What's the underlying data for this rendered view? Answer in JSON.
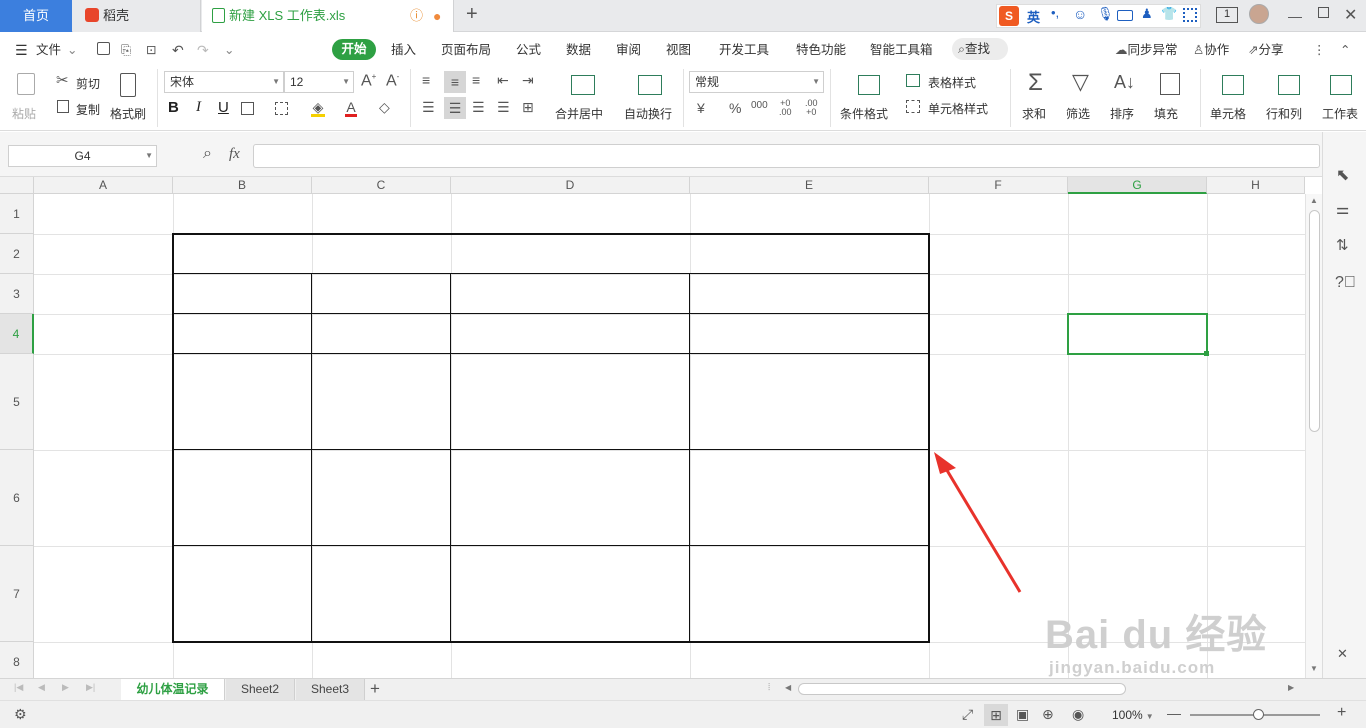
{
  "tabs": {
    "home": "首页",
    "docer": "稻壳",
    "doc": "新建 XLS 工作表.xls"
  },
  "ribbon_tabs": [
    "开始",
    "插入",
    "页面布局",
    "公式",
    "数据",
    "审阅",
    "视图",
    "开发工具",
    "特色功能",
    "智能工具箱"
  ],
  "menu": {
    "file": "文件",
    "search": "查找",
    "sync": "同步异常",
    "collab": "协作",
    "share": "分享"
  },
  "ime": {
    "mode": "英",
    "badge": "1"
  },
  "toolbar": {
    "paste": "粘贴",
    "cut": "剪切",
    "copy": "复制",
    "format_painter": "格式刷",
    "font": "宋体",
    "size": "12",
    "num_format": "常规",
    "merge": "合并居中",
    "wrap": "自动换行",
    "cond_format": "条件格式",
    "table_style": "表格样式",
    "cell_style": "单元格样式",
    "sum": "求和",
    "filter": "筛选",
    "sort": "排序",
    "fill": "填充",
    "cell": "单元格",
    "rowcol": "行和列",
    "sheet": "工作表"
  },
  "formula_bar": {
    "name_box": "G4",
    "fx": "fx",
    "value": ""
  },
  "columns": [
    "A",
    "B",
    "C",
    "D",
    "E",
    "F",
    "G",
    "H"
  ],
  "rows": [
    "1",
    "2",
    "3",
    "4",
    "5",
    "6",
    "7",
    "8"
  ],
  "sheets": [
    "幼儿体温记录",
    "Sheet2",
    "Sheet3"
  ],
  "status": {
    "zoom": "100%"
  },
  "watermark": {
    "brand": "Bai du 经验",
    "url": "jingyan.baidu.com"
  },
  "colors": {
    "accent": "#3c7fde",
    "green": "#2ea043",
    "arrow": "#e8322b"
  }
}
